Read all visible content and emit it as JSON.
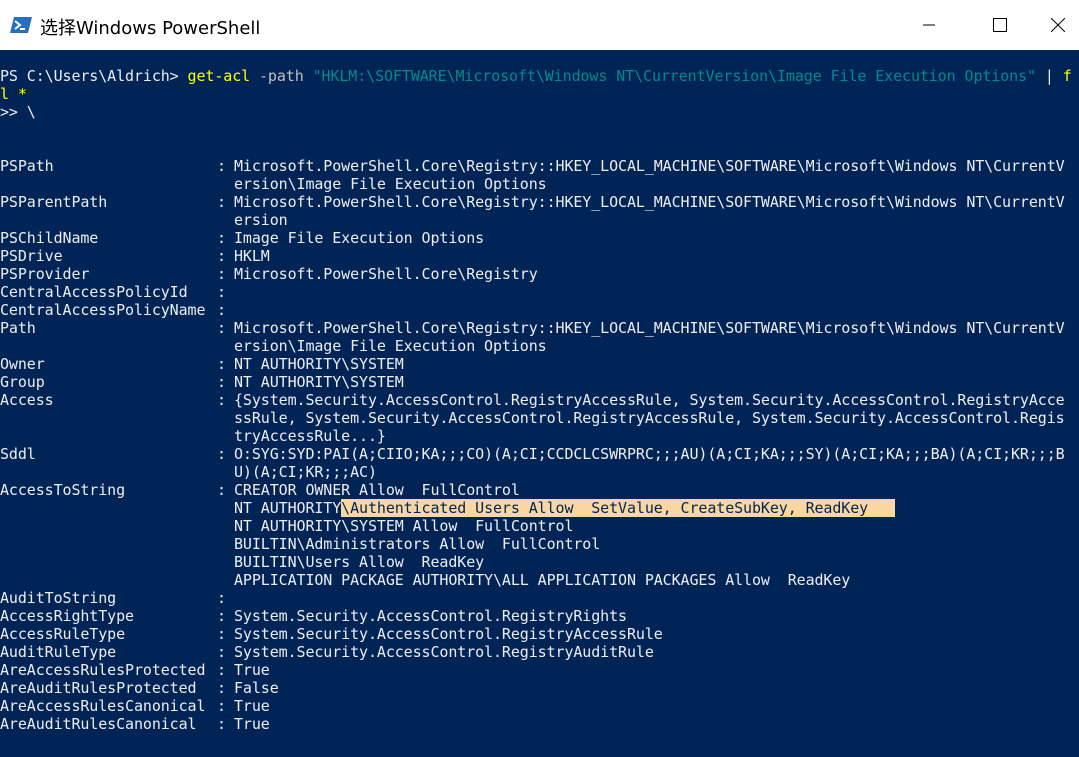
{
  "window": {
    "title": "选择Windows PowerShell",
    "icon": "powershell-icon",
    "controls": [
      "minimize-icon",
      "maximize-icon",
      "close-icon"
    ]
  },
  "colors": {
    "console_bg": "#012456",
    "text": "#eeedf0",
    "command": "#ffff00",
    "parameter": "#c0c0c0",
    "string": "#008b8b",
    "selection": "#fad7a0"
  },
  "command": {
    "prompt": "PS C:\\Users\\Aldrich> ",
    "cmdlet": "get-acl",
    "param": " -path ",
    "path_string": "\"HKLM:\\SOFTWARE\\Microsoft\\Windows NT\\CurrentVersion\\Image File Execution Options\"",
    "pipe": " | ",
    "overflow": "f",
    "line2": "l *",
    "line3": ">> \\"
  },
  "properties": [
    {
      "name": "PSPath",
      "lines": [
        "Microsoft.PowerShell.Core\\Registry::HKEY_LOCAL_MACHINE\\SOFTWARE\\Microsoft\\Windows NT\\CurrentV",
        "ersion\\Image File Execution Options"
      ]
    },
    {
      "name": "PSParentPath",
      "lines": [
        "Microsoft.PowerShell.Core\\Registry::HKEY_LOCAL_MACHINE\\SOFTWARE\\Microsoft\\Windows NT\\CurrentV",
        "ersion"
      ]
    },
    {
      "name": "PSChildName",
      "lines": [
        "Image File Execution Options"
      ]
    },
    {
      "name": "PSDrive",
      "lines": [
        "HKLM"
      ]
    },
    {
      "name": "PSProvider",
      "lines": [
        "Microsoft.PowerShell.Core\\Registry"
      ]
    },
    {
      "name": "CentralAccessPolicyId",
      "lines": [
        ""
      ]
    },
    {
      "name": "CentralAccessPolicyName",
      "lines": [
        ""
      ]
    },
    {
      "name": "Path",
      "lines": [
        "Microsoft.PowerShell.Core\\Registry::HKEY_LOCAL_MACHINE\\SOFTWARE\\Microsoft\\Windows NT\\CurrentV",
        "ersion\\Image File Execution Options"
      ]
    },
    {
      "name": "Owner",
      "lines": [
        "NT AUTHORITY\\SYSTEM"
      ]
    },
    {
      "name": "Group",
      "lines": [
        "NT AUTHORITY\\SYSTEM"
      ]
    },
    {
      "name": "Access",
      "lines": [
        "{System.Security.AccessControl.RegistryAccessRule, System.Security.AccessControl.RegistryAcce",
        "ssRule, System.Security.AccessControl.RegistryAccessRule, System.Security.AccessControl.Regis",
        "tryAccessRule...}"
      ]
    },
    {
      "name": "Sddl",
      "lines": [
        "O:SYG:SYD:PAI(A;CIIO;KA;;;CO)(A;CI;CCDCLCSWRPRC;;;AU)(A;CI;KA;;;SY)(A;CI;KA;;;BA)(A;CI;KR;;;B",
        "U)(A;CI;KR;;;AC)"
      ]
    },
    {
      "name": "AccessToString",
      "lines": [
        "CREATOR OWNER Allow  FullControl",
        "NT AUTHORITY",
        "NT AUTHORITY\\SYSTEM Allow  FullControl",
        "BUILTIN\\Administrators Allow  FullControl",
        "BUILTIN\\Users Allow  ReadKey",
        "APPLICATION PACKAGE AUTHORITY\\ALL APPLICATION PACKAGES Allow  ReadKey"
      ]
    },
    {
      "name": "AuditToString",
      "lines": [
        ""
      ]
    },
    {
      "name": "AccessRightType",
      "lines": [
        "System.Security.AccessControl.RegistryRights"
      ]
    },
    {
      "name": "AccessRuleType",
      "lines": [
        "System.Security.AccessControl.RegistryAccessRule"
      ]
    },
    {
      "name": "AuditRuleType",
      "lines": [
        "System.Security.AccessControl.RegistryAuditRule"
      ]
    },
    {
      "name": "AreAccessRulesProtected",
      "lines": [
        "True"
      ]
    },
    {
      "name": "AreAuditRulesProtected",
      "lines": [
        "False"
      ]
    },
    {
      "name": "AreAccessRulesCanonical",
      "lines": [
        "True"
      ]
    },
    {
      "name": "AreAuditRulesCanonical",
      "lines": [
        "True"
      ]
    }
  ],
  "selection": {
    "text": "\\Authenticated Users Allow  SetValue, CreateSubKey, ReadKey   "
  },
  "separator": ":"
}
